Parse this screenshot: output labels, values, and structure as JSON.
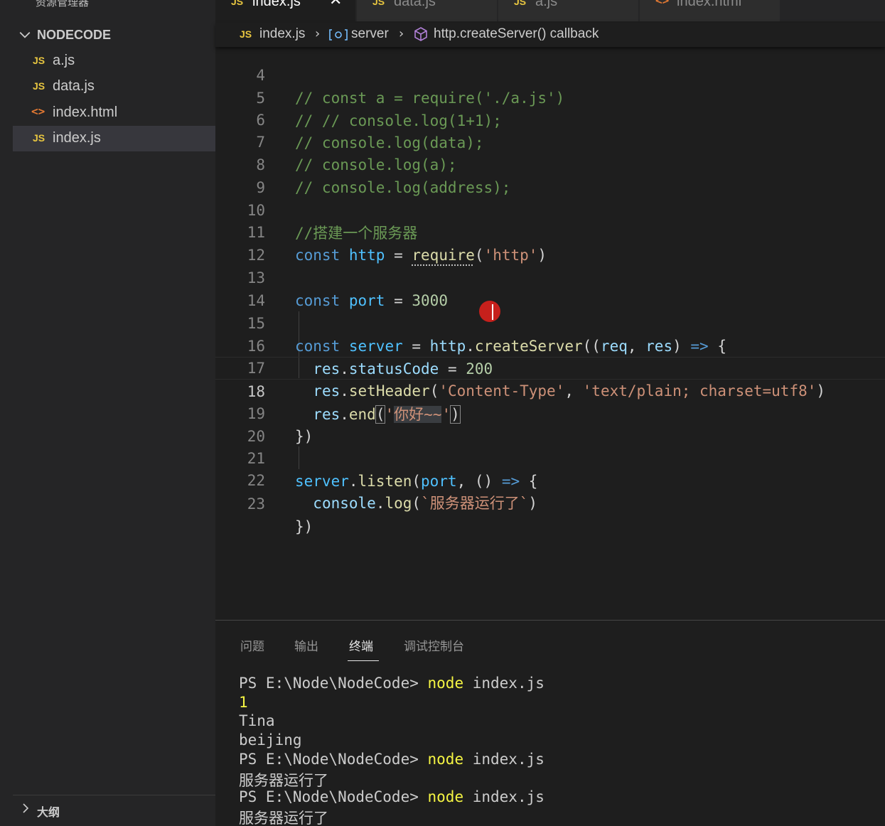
{
  "sidebar": {
    "title": "资源管理器",
    "more": "···",
    "folder": "NODECODE",
    "files": [
      {
        "icon": "JS",
        "name": "a.js"
      },
      {
        "icon": "JS",
        "name": "data.js"
      },
      {
        "icon": "<>",
        "name": "index.html"
      },
      {
        "icon": "JS",
        "name": "index.js"
      }
    ],
    "outline": "大纲"
  },
  "tabs": [
    {
      "icon": "JS",
      "label": "index.js",
      "close": "✕"
    },
    {
      "icon": "JS",
      "label": "data.js"
    },
    {
      "icon": "JS",
      "label": "a.js"
    },
    {
      "icon": "<>",
      "label": "index.html"
    }
  ],
  "breadcrumb": {
    "icon": "JS",
    "file": "index.js",
    "symbol": "server",
    "callback": "http.createServer() callback"
  },
  "editor": {
    "line_numbers": [
      "4",
      "5",
      "6",
      "7",
      "8",
      "9",
      "10",
      "11",
      "12",
      "13",
      "14",
      "15",
      "16",
      "17",
      "18",
      "19",
      "20",
      "21",
      "22",
      "23"
    ],
    "line4": "// const a = require('./a.js')",
    "line5": "// // console.log(1+1);",
    "line6": "// console.log(data);",
    "line7": "// console.log(a);",
    "line8": "// console.log(address);",
    "line10": "//搭建一个服务器",
    "tok": {
      "const": "const",
      "http": "http",
      "eq": " = ",
      "require": "require",
      "open": "(",
      "http_str": "'http'",
      "close": ")",
      "port": "port",
      "port_val": "3000",
      "server": "server",
      "dot": ".",
      "createServer": "createServer",
      "params_open": "((",
      "req": "req",
      "comma": ", ",
      "res": "res",
      "params_close": ") ",
      "arrow": "=>",
      "brace_open": " {",
      "statusCode": "statusCode",
      "status_val": "200",
      "setHeader": "setHeader",
      "ct_key": "'Content-Type'",
      "ct_val": "'text/plain; charset=utf8'",
      "end": "end",
      "quote": "'",
      "hello": "你好~~",
      "brace_close": "})",
      "listen": "listen",
      "empty_parens": " () ",
      "console": "console",
      "log": "log",
      "running": "`服务器运行了`"
    }
  },
  "panel": {
    "tabs": [
      "问题",
      "输出",
      "终端",
      "调试控制台"
    ],
    "active_tab": "终端",
    "prompt": "PS E:\\Node\\NodeCode> ",
    "cmd": "node",
    "cmd_arg": " index.js",
    "out1": "1",
    "out2": "Tina",
    "out3": "beijing",
    "out4": "服务器运行了",
    "out5": "服务器运行了"
  },
  "colors": {
    "js_icon": "#e8c640",
    "html_icon": "#e37933",
    "keyword": "#569cd6",
    "string": "#ce9178",
    "comment": "#6a9955",
    "terminal_cmd": "#f5f543"
  }
}
